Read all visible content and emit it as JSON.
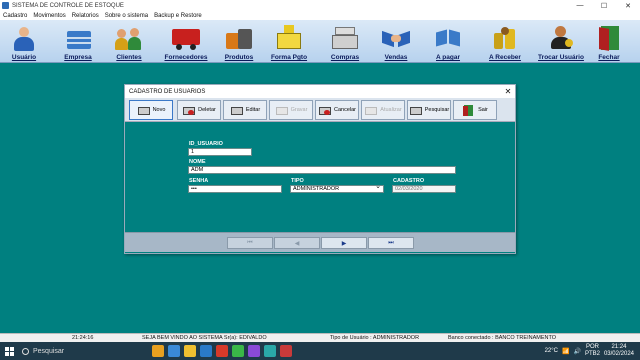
{
  "window": {
    "title": "SISTEMA DE CONTROLE DE ESTOQUE",
    "minimize": "—",
    "maximize": "☐",
    "close": "✕"
  },
  "menu": [
    "Cadastro",
    "Movimentos",
    "Relatorios",
    "Sobre o sistema",
    "Backup e Restore"
  ],
  "toolbar": [
    {
      "label": "Usuário",
      "icon": "user-icon"
    },
    {
      "label": "Empresa",
      "icon": "building-icon"
    },
    {
      "label": "Clientes",
      "icon": "clients-icon"
    },
    {
      "label": "Fornecedores",
      "icon": "truck-icon"
    },
    {
      "label": "Produtos",
      "icon": "products-icon"
    },
    {
      "label": "Forma Pgto",
      "icon": "payment-icon"
    },
    {
      "label": "Compras",
      "icon": "cash-register-icon"
    },
    {
      "label": "Vendas",
      "icon": "handshake-icon"
    },
    {
      "label": "A pagar",
      "icon": "payable-icon"
    },
    {
      "label": "A Receber",
      "icon": "coins-icon"
    },
    {
      "label": "Trocar Usuário",
      "icon": "switch-user-icon"
    },
    {
      "label": "Fechar",
      "icon": "exit-door-icon"
    }
  ],
  "dialog": {
    "title": "CADASTRO DE USUARIOS",
    "close": "✕",
    "buttons": [
      {
        "label": "Novo",
        "enabled": true,
        "active": true
      },
      {
        "label": "Deletar",
        "enabled": true
      },
      {
        "label": "Editar",
        "enabled": true
      },
      {
        "label": "Gravar",
        "enabled": false
      },
      {
        "label": "Cancelar",
        "enabled": true
      },
      {
        "label": "Atualizar",
        "enabled": false
      },
      {
        "label": "Pesquisar",
        "enabled": true
      },
      {
        "label": "Sair",
        "enabled": true
      }
    ],
    "fields": {
      "id_label": "ID_USUARIO",
      "id_value": "1",
      "nome_label": "NOME",
      "nome_value": "ADM",
      "senha_label": "SENHA",
      "senha_value": "•••",
      "tipo_label": "TIPO",
      "tipo_value": "ADMINISTRADOR",
      "cadastro_label": "CADASTRO",
      "cadastro_value": "02/03/2020"
    },
    "nav": [
      "⏮",
      "◀",
      "▶",
      "⏭"
    ]
  },
  "status": {
    "time": "21:24:16",
    "welcome": "SEJA BEM VINDO AO SISTEMA Sr(a): EDIVALDO",
    "user_type": "Tipo de Usuário : ADMINISTRADOR",
    "db": "Banco conectado : BANCO TREINAMENTO"
  },
  "taskbar": {
    "search_placeholder": "Pesquisar",
    "temp": "22°C",
    "lang1": "POR",
    "lang2": "PTB2",
    "clock_time": "21:24",
    "clock_date": "03/02/2024"
  }
}
